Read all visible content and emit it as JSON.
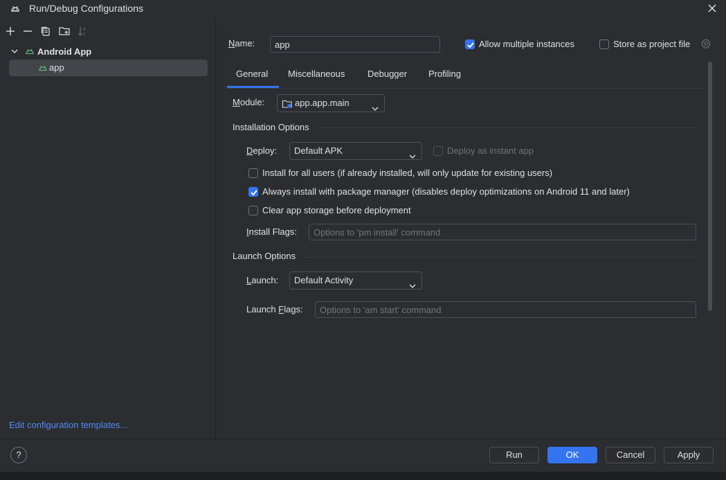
{
  "window": {
    "title": "Run/Debug Configurations",
    "icon": "android-icon",
    "close_icon": "close-icon"
  },
  "toolbar": {
    "icons": [
      "add-icon",
      "remove-icon",
      "copy-icon",
      "move-to-folder-icon",
      "sort-icon"
    ]
  },
  "tree": {
    "group_label": "Android App",
    "item_label": "app"
  },
  "edit_templates_link": "Edit configuration templates...",
  "header": {
    "name_label_u": "N",
    "name_label_rest": "ame:",
    "name_value": "app",
    "allow_multiple_label": "Allow multiple instances",
    "allow_multiple_checked": true,
    "store_project_label": "Store as project file",
    "store_project_checked": false
  },
  "tabs": [
    "General",
    "Miscellaneous",
    "Debugger",
    "Profiling"
  ],
  "active_tab": "General",
  "general": {
    "module_label_u": "M",
    "module_label_rest": "odule:",
    "module_value": "app.app.main",
    "installation_options_title": "Installation Options",
    "deploy_label_u": "D",
    "deploy_label_rest": "eploy:",
    "deploy_value": "Default APK",
    "deploy_instant_label": "Deploy as instant app",
    "install_all_users_label": "Install for all users (if already installed, will only update for existing users)",
    "install_all_users_checked": false,
    "always_install_label": "Always install with package manager (disables deploy optimizations on Android 11 and later)",
    "always_install_checked": true,
    "clear_storage_label": "Clear app storage before deployment",
    "clear_storage_checked": false,
    "install_flags_label_u": "I",
    "install_flags_label_rest": "nstall Flags:",
    "install_flags_placeholder": "Options to 'pm install' command",
    "launch_options_title": "Launch Options",
    "launch_label_u": "L",
    "launch_label_rest": "aunch:",
    "launch_value": "Default Activity",
    "launch_flags_label_pre": "Launch ",
    "launch_flags_label_u": "F",
    "launch_flags_label_rest": "lags:",
    "launch_flags_placeholder": "Options to 'am start' command"
  },
  "buttons": {
    "help": "?",
    "run": "Run",
    "ok": "OK",
    "cancel": "Cancel",
    "apply": "Apply"
  },
  "colors": {
    "background": "#2b2d30",
    "accent": "#3574f0",
    "link": "#548af7",
    "android_green": "#5fb878"
  }
}
